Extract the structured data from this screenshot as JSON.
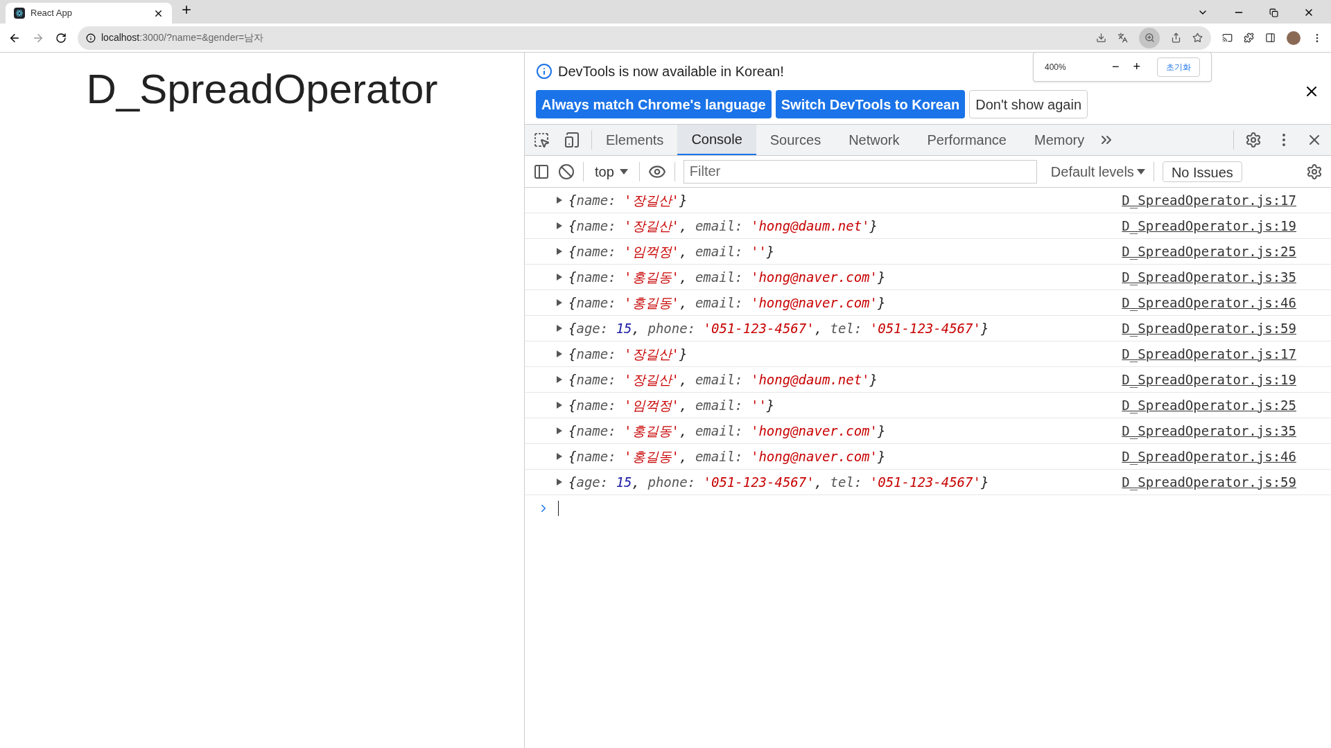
{
  "browser": {
    "tab_title": "React App",
    "url_host": "localhost",
    "url_rest": ":3000/?name=&gender=남자"
  },
  "zoom_popup": {
    "level": "400%",
    "minus": "−",
    "plus": "+",
    "reset": "초기화"
  },
  "page": {
    "heading": "D_SpreadOperator"
  },
  "devtools": {
    "info": "DevTools is now available in Korean!",
    "info_buttons": [
      {
        "label": "Always match Chrome's language",
        "kind": "primary"
      },
      {
        "label": "Switch DevTools to Korean",
        "kind": "primary"
      },
      {
        "label": "Don't show again",
        "kind": "secondary"
      }
    ],
    "tabs": [
      {
        "label": "Elements",
        "selected": false
      },
      {
        "label": "Console",
        "selected": true
      },
      {
        "label": "Sources",
        "selected": false
      },
      {
        "label": "Network",
        "selected": false
      },
      {
        "label": "Performance",
        "selected": false
      },
      {
        "label": "Memory",
        "selected": false
      }
    ],
    "context": "top",
    "filter_placeholder": "Filter",
    "levels": "Default levels",
    "issues": "No Issues",
    "messages": [
      {
        "tokens": [
          {
            "kind": "punct",
            "text": "{"
          },
          {
            "kind": "key",
            "text": "name: "
          },
          {
            "kind": "string",
            "text": "'장길산'"
          },
          {
            "kind": "punct",
            "text": "}"
          }
        ],
        "source": "D_SpreadOperator.js:17"
      },
      {
        "tokens": [
          {
            "kind": "punct",
            "text": "{"
          },
          {
            "kind": "key",
            "text": "name: "
          },
          {
            "kind": "string",
            "text": "'장길산'"
          },
          {
            "kind": "punct",
            "text": ", "
          },
          {
            "kind": "key",
            "text": "email: "
          },
          {
            "kind": "string",
            "text": "'hong@daum.net'"
          },
          {
            "kind": "punct",
            "text": "}"
          }
        ],
        "source": "D_SpreadOperator.js:19"
      },
      {
        "tokens": [
          {
            "kind": "punct",
            "text": "{"
          },
          {
            "kind": "key",
            "text": "name: "
          },
          {
            "kind": "string",
            "text": "'임꺽정'"
          },
          {
            "kind": "punct",
            "text": ", "
          },
          {
            "kind": "key",
            "text": "email: "
          },
          {
            "kind": "string",
            "text": "''"
          },
          {
            "kind": "punct",
            "text": "}"
          }
        ],
        "source": "D_SpreadOperator.js:25"
      },
      {
        "tokens": [
          {
            "kind": "punct",
            "text": "{"
          },
          {
            "kind": "key",
            "text": "name: "
          },
          {
            "kind": "string",
            "text": "'홍길동'"
          },
          {
            "kind": "punct",
            "text": ", "
          },
          {
            "kind": "key",
            "text": "email: "
          },
          {
            "kind": "string",
            "text": "'hong@naver.com'"
          },
          {
            "kind": "punct",
            "text": "}"
          }
        ],
        "source": "D_SpreadOperator.js:35"
      },
      {
        "tokens": [
          {
            "kind": "punct",
            "text": "{"
          },
          {
            "kind": "key",
            "text": "name: "
          },
          {
            "kind": "string",
            "text": "'홍길동'"
          },
          {
            "kind": "punct",
            "text": ", "
          },
          {
            "kind": "key",
            "text": "email: "
          },
          {
            "kind": "string",
            "text": "'hong@naver.com'"
          },
          {
            "kind": "punct",
            "text": "}"
          }
        ],
        "source": "D_SpreadOperator.js:46"
      },
      {
        "tokens": [
          {
            "kind": "punct",
            "text": "{"
          },
          {
            "kind": "key",
            "text": "age: "
          },
          {
            "kind": "number",
            "text": "15"
          },
          {
            "kind": "punct",
            "text": ", "
          },
          {
            "kind": "key",
            "text": "phone: "
          },
          {
            "kind": "string",
            "text": "'051-123-4567'"
          },
          {
            "kind": "punct",
            "text": ", "
          },
          {
            "kind": "key",
            "text": "tel: "
          },
          {
            "kind": "string",
            "text": "'051-123-4567'"
          },
          {
            "kind": "punct",
            "text": "}"
          }
        ],
        "source": "D_SpreadOperator.js:59"
      },
      {
        "tokens": [
          {
            "kind": "punct",
            "text": "{"
          },
          {
            "kind": "key",
            "text": "name: "
          },
          {
            "kind": "string",
            "text": "'장길산'"
          },
          {
            "kind": "punct",
            "text": "}"
          }
        ],
        "source": "D_SpreadOperator.js:17"
      },
      {
        "tokens": [
          {
            "kind": "punct",
            "text": "{"
          },
          {
            "kind": "key",
            "text": "name: "
          },
          {
            "kind": "string",
            "text": "'장길산'"
          },
          {
            "kind": "punct",
            "text": ", "
          },
          {
            "kind": "key",
            "text": "email: "
          },
          {
            "kind": "string",
            "text": "'hong@daum.net'"
          },
          {
            "kind": "punct",
            "text": "}"
          }
        ],
        "source": "D_SpreadOperator.js:19"
      },
      {
        "tokens": [
          {
            "kind": "punct",
            "text": "{"
          },
          {
            "kind": "key",
            "text": "name: "
          },
          {
            "kind": "string",
            "text": "'임꺽정'"
          },
          {
            "kind": "punct",
            "text": ", "
          },
          {
            "kind": "key",
            "text": "email: "
          },
          {
            "kind": "string",
            "text": "''"
          },
          {
            "kind": "punct",
            "text": "}"
          }
        ],
        "source": "D_SpreadOperator.js:25"
      },
      {
        "tokens": [
          {
            "kind": "punct",
            "text": "{"
          },
          {
            "kind": "key",
            "text": "name: "
          },
          {
            "kind": "string",
            "text": "'홍길동'"
          },
          {
            "kind": "punct",
            "text": ", "
          },
          {
            "kind": "key",
            "text": "email: "
          },
          {
            "kind": "string",
            "text": "'hong@naver.com'"
          },
          {
            "kind": "punct",
            "text": "}"
          }
        ],
        "source": "D_SpreadOperator.js:35"
      },
      {
        "tokens": [
          {
            "kind": "punct",
            "text": "{"
          },
          {
            "kind": "key",
            "text": "name: "
          },
          {
            "kind": "string",
            "text": "'홍길동'"
          },
          {
            "kind": "punct",
            "text": ", "
          },
          {
            "kind": "key",
            "text": "email: "
          },
          {
            "kind": "string",
            "text": "'hong@naver.com'"
          },
          {
            "kind": "punct",
            "text": "}"
          }
        ],
        "source": "D_SpreadOperator.js:46"
      },
      {
        "tokens": [
          {
            "kind": "punct",
            "text": "{"
          },
          {
            "kind": "key",
            "text": "age: "
          },
          {
            "kind": "number",
            "text": "15"
          },
          {
            "kind": "punct",
            "text": ", "
          },
          {
            "kind": "key",
            "text": "phone: "
          },
          {
            "kind": "string",
            "text": "'051-123-4567'"
          },
          {
            "kind": "punct",
            "text": ", "
          },
          {
            "kind": "key",
            "text": "tel: "
          },
          {
            "kind": "string",
            "text": "'051-123-4567'"
          },
          {
            "kind": "punct",
            "text": "}"
          }
        ],
        "source": "D_SpreadOperator.js:59"
      }
    ]
  }
}
